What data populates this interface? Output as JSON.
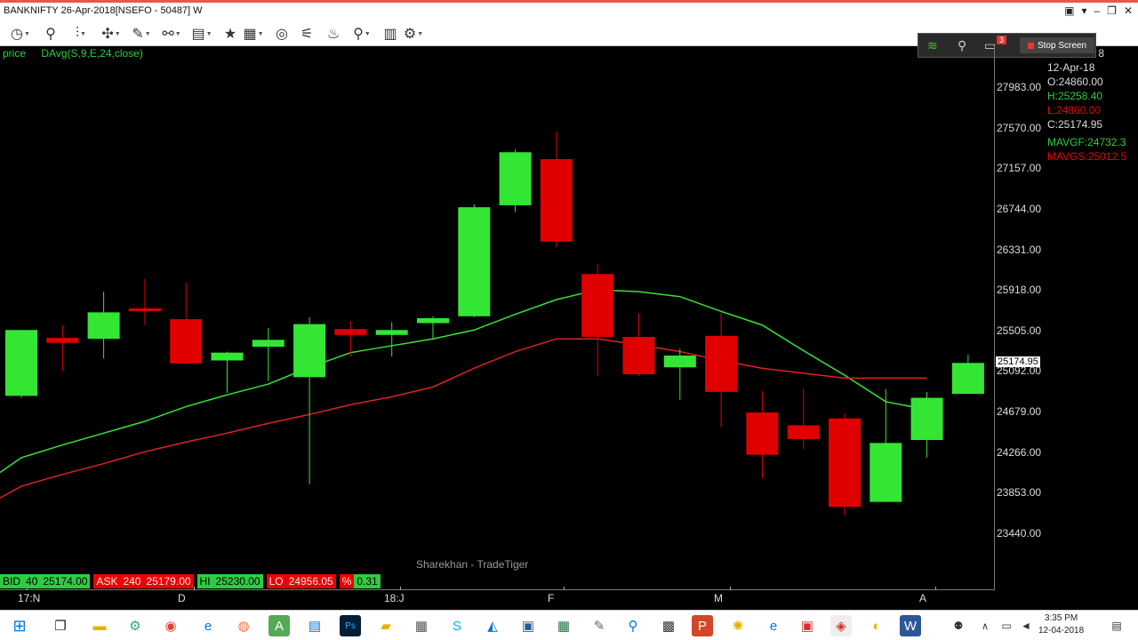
{
  "window": {
    "title": "BANKNIFTY 26-Apr-2018[NSEFO - 50487] W"
  },
  "toolbar": {
    "icons": [
      "clock-icon",
      "pin-icon",
      "indicator-icon",
      "crosshair-icon",
      "draw-icon",
      "line-tool-icon",
      "template-icon",
      "favorite-icon",
      "layout-icon",
      "target-icon",
      "telescope-icon",
      "alert-icon",
      "zoom-icon",
      "delete-icon",
      "settings-icon"
    ]
  },
  "tray": {
    "notif_count": "3",
    "stop_label": "Stop Screen"
  },
  "legend": {
    "price": "price",
    "indicator": "DAvg(S,9,E,24,close)"
  },
  "info": {
    "date_top": "8",
    "date": "12-Apr-18",
    "open": "O:24860.00",
    "high": "H:25258.40",
    "low": "L:24860.00",
    "close": "C:25174.95",
    "mavgf": "MAVGF:24732.3",
    "mavgs": "MAVGS:25012.5"
  },
  "current_price": "25174.95",
  "watermark": "Sharekhan - TradeTiger",
  "bidbar": {
    "bid_label": "BID",
    "bid_qty": "40",
    "bid_price": "25174.00",
    "ask_label": "ASK",
    "ask_qty": "240",
    "ask_price": "25179.00",
    "hi_label": "HI",
    "hi_price": "25230.00",
    "lo_label": "LO",
    "lo_price": "24956.05",
    "pct_label": "%",
    "pct": "0.31"
  },
  "colors": {
    "up": "#33e633",
    "down": "#e00000",
    "fast_ma": "#33e633",
    "slow_ma": "#dd2222",
    "bg": "#000000"
  },
  "chart_data": {
    "type": "candlestick",
    "y_ticks": [
      "27983.00",
      "27570.00",
      "27157.00",
      "26744.00",
      "26331.00",
      "25918.00",
      "25505.00",
      "25092.00",
      "24679.00",
      "24266.00",
      "23853.00",
      "23440.00"
    ],
    "ylim": [
      23440,
      27983
    ],
    "x_ticks": [
      "17:N",
      "D",
      "18:J",
      "F",
      "M",
      "A"
    ],
    "candles": [
      {
        "o": 24840,
        "h": 25260,
        "l": 24820,
        "c": 25510
      },
      {
        "o": 25430,
        "h": 25560,
        "l": 25090,
        "c": 25380
      },
      {
        "o": 25420,
        "h": 25900,
        "l": 25220,
        "c": 25690
      },
      {
        "o": 25730,
        "h": 26030,
        "l": 25560,
        "c": 25720
      },
      {
        "o": 25620,
        "h": 25990,
        "l": 25160,
        "c": 25170
      },
      {
        "o": 25200,
        "h": 25290,
        "l": 24870,
        "c": 25280
      },
      {
        "o": 25340,
        "h": 25530,
        "l": 24990,
        "c": 25410
      },
      {
        "o": 25030,
        "h": 25640,
        "l": 23940,
        "c": 25570
      },
      {
        "o": 25520,
        "h": 25600,
        "l": 25240,
        "c": 25460
      },
      {
        "o": 25460,
        "h": 25590,
        "l": 25240,
        "c": 25510
      },
      {
        "o": 25580,
        "h": 25650,
        "l": 25410,
        "c": 25630
      },
      {
        "o": 25650,
        "h": 26790,
        "l": 25640,
        "c": 26760
      },
      {
        "o": 26780,
        "h": 27350,
        "l": 26710,
        "c": 27320
      },
      {
        "o": 27250,
        "h": 27530,
        "l": 26350,
        "c": 26410
      },
      {
        "o": 26080,
        "h": 26180,
        "l": 25040,
        "c": 25440
      },
      {
        "o": 25440,
        "h": 25680,
        "l": 25040,
        "c": 25060
      },
      {
        "o": 25130,
        "h": 25320,
        "l": 24800,
        "c": 25250
      },
      {
        "o": 25450,
        "h": 25690,
        "l": 24520,
        "c": 24880
      },
      {
        "o": 24670,
        "h": 24890,
        "l": 24000,
        "c": 24240
      },
      {
        "o": 24540,
        "h": 24910,
        "l": 24300,
        "c": 24400
      },
      {
        "o": 24610,
        "h": 24660,
        "l": 23620,
        "c": 23710
      },
      {
        "o": 23760,
        "h": 24910,
        "l": 23760,
        "c": 24360
      },
      {
        "o": 24390,
        "h": 24880,
        "l": 24210,
        "c": 24820
      },
      {
        "o": 24860,
        "h": 25258,
        "l": 24860,
        "c": 25175
      }
    ],
    "series": [
      {
        "name": "MAVGF",
        "values": [
          24210,
          24340,
          24460,
          24580,
          24730,
          24850,
          24960,
          25130,
          25280,
          25350,
          25420,
          25510,
          25670,
          25820,
          25920,
          25900,
          25850,
          25700,
          25560,
          25300,
          25050,
          24780,
          24700
        ]
      },
      {
        "name": "MAVGS",
        "values": [
          23920,
          24040,
          24150,
          24270,
          24370,
          24460,
          24560,
          24650,
          24750,
          24830,
          24930,
          25120,
          25290,
          25420,
          25420,
          25360,
          25290,
          25200,
          25120,
          25070,
          25020,
          25020,
          25020
        ]
      }
    ]
  }
}
